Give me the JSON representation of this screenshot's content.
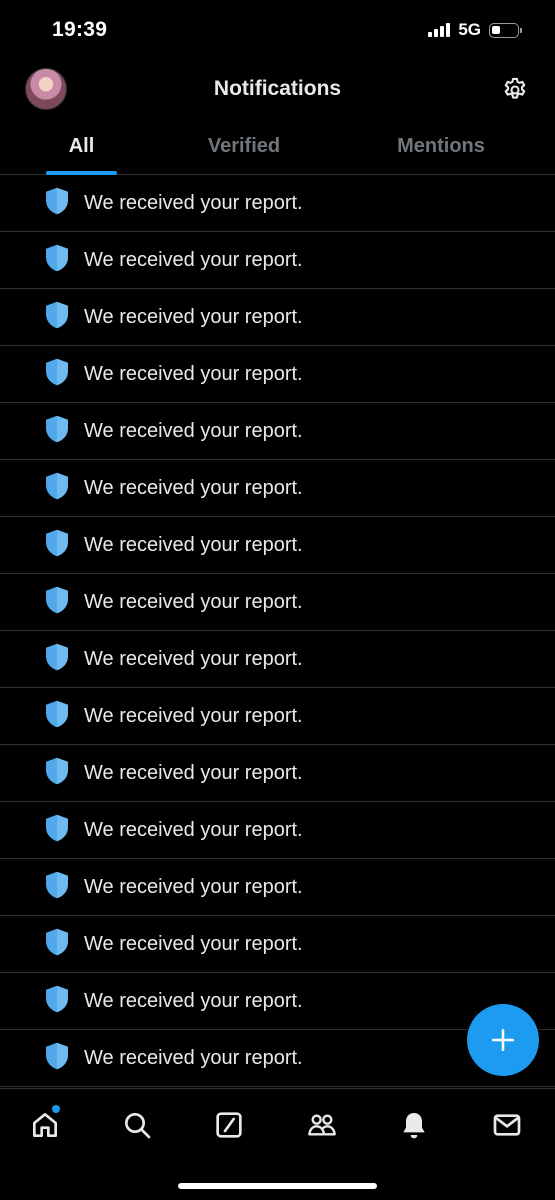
{
  "status_bar": {
    "time": "19:39",
    "network": "5G",
    "battery_level": 0.35
  },
  "header": {
    "title": "Notifications",
    "avatar_icon": "user-avatar",
    "settings_icon": "gear-icon"
  },
  "tabs": [
    {
      "label": "All",
      "active": true
    },
    {
      "label": "Verified",
      "active": false
    },
    {
      "label": "Mentions",
      "active": false
    }
  ],
  "notifications": [
    {
      "icon": "shield-icon",
      "text": "We received your report."
    },
    {
      "icon": "shield-icon",
      "text": "We received your report."
    },
    {
      "icon": "shield-icon",
      "text": "We received your report."
    },
    {
      "icon": "shield-icon",
      "text": "We received your report."
    },
    {
      "icon": "shield-icon",
      "text": "We received your report."
    },
    {
      "icon": "shield-icon",
      "text": "We received your report."
    },
    {
      "icon": "shield-icon",
      "text": "We received your report."
    },
    {
      "icon": "shield-icon",
      "text": "We received your report."
    },
    {
      "icon": "shield-icon",
      "text": "We received your report."
    },
    {
      "icon": "shield-icon",
      "text": "We received your report."
    },
    {
      "icon": "shield-icon",
      "text": "We received your report."
    },
    {
      "icon": "shield-icon",
      "text": "We received your report."
    },
    {
      "icon": "shield-icon",
      "text": "We received your report."
    },
    {
      "icon": "shield-icon",
      "text": "We received your report."
    },
    {
      "icon": "shield-icon",
      "text": "We received your report."
    },
    {
      "icon": "shield-icon",
      "text": "We received your report."
    }
  ],
  "fab_icon": "plus-icon",
  "bottom_nav": [
    {
      "icon": "home-icon",
      "has_badge": true
    },
    {
      "icon": "search-icon"
    },
    {
      "icon": "grok-icon"
    },
    {
      "icon": "communities-icon"
    },
    {
      "icon": "bell-icon"
    },
    {
      "icon": "mail-icon"
    }
  ],
  "colors": {
    "accent": "#1d9bf0",
    "shield": "#4fa9ea",
    "background": "#000000",
    "divider": "#2f3336",
    "inactive_tab": "#71767b"
  }
}
